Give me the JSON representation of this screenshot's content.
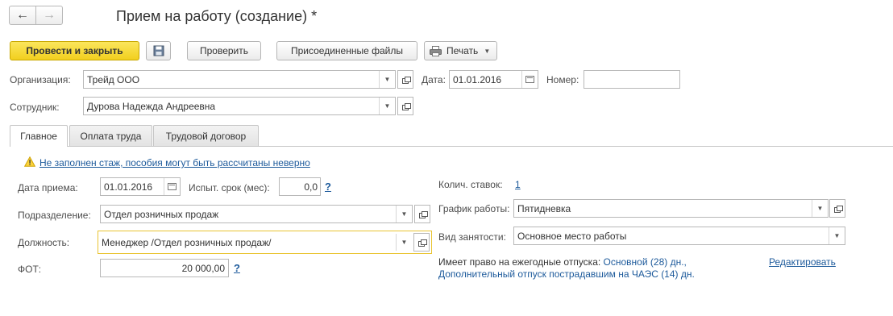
{
  "window": {
    "title": "Прием на работу (создание) *"
  },
  "nav": {
    "back_icon": "←",
    "forward_icon": "→"
  },
  "toolbar": {
    "post_close": "Провести и закрыть",
    "check": "Проверить",
    "attached_files": "Присоединенные файлы",
    "print": "Печать"
  },
  "header": {
    "org_label": "Организация:",
    "org_value": "Трейд ООО",
    "date_label": "Дата:",
    "date_value": "01.01.2016",
    "number_label": "Номер:",
    "number_value": "",
    "employee_label": "Сотрудник:",
    "employee_value": "Дурова Надежда Андреевна"
  },
  "tabs": [
    {
      "label": "Главное"
    },
    {
      "label": "Оплата труда"
    },
    {
      "label": "Трудовой договор"
    }
  ],
  "main": {
    "warning_text": "Не заполнен стаж, пособия могут быть рассчитаны неверно",
    "hire_date_label": "Дата приема:",
    "hire_date_value": "01.01.2016",
    "probation_label": "Испыт. срок (мес):",
    "probation_value": "0,0",
    "question_mark": "?",
    "department_label": "Подразделение:",
    "department_value": "Отдел розничных продаж",
    "position_label": "Должность:",
    "position_value": "Менеджер /Отдел розничных продаж/",
    "fot_label": "ФОТ:",
    "fot_value": "20 000,00",
    "rates_label": "Колич. ставок:",
    "rates_value": "1",
    "schedule_label": "График работы:",
    "schedule_value": "Пятидневка",
    "employment_label": "Вид занятости:",
    "employment_value": "Основное место работы",
    "vacation_label": "Имеет право на ежегодные отпуска:",
    "vacation_main": "Основной (28) дн.,",
    "vacation_extra": "Дополнительный отпуск пострадавшим на ЧАЭС (14) дн.",
    "edit_link": "Редактировать"
  },
  "colors": {
    "accent": "#f2cf1e",
    "link": "#1d5a9b",
    "focus": "#e9c432"
  }
}
